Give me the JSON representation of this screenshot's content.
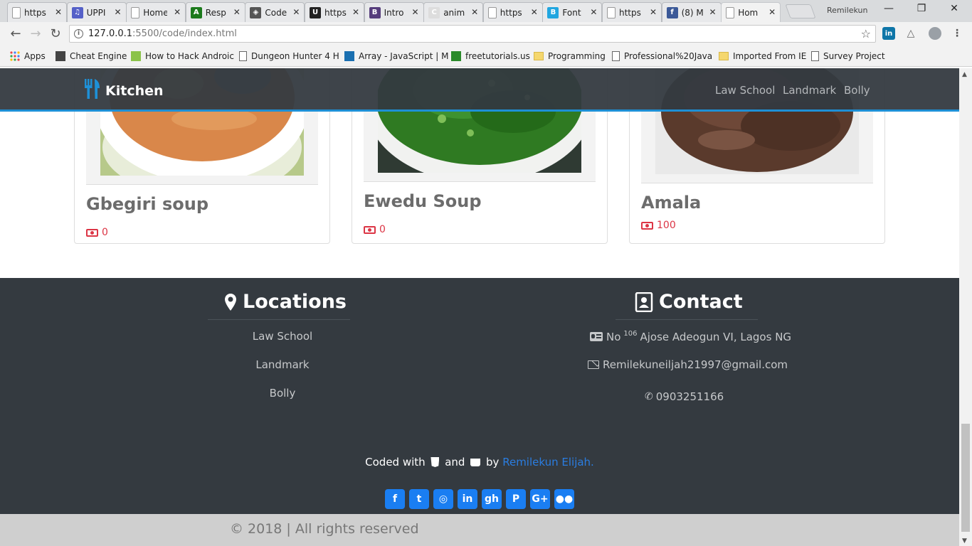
{
  "browser": {
    "tabs": [
      {
        "title": "https",
        "favicon": "page-icon",
        "color": "#999999",
        "letter": ""
      },
      {
        "title": "UPPI",
        "favicon": "itunes-icon",
        "color": "#5560c8",
        "letter": "♫"
      },
      {
        "title": "Home",
        "favicon": "page-icon",
        "color": "#999999",
        "letter": ""
      },
      {
        "title": "Resp",
        "favicon": "green-icon",
        "color": "#1c7a1c",
        "letter": "A"
      },
      {
        "title": "Code",
        "favicon": "codepen-icon",
        "color": "#555555",
        "letter": "◈"
      },
      {
        "title": "https",
        "favicon": "udemy-icon",
        "color": "#222222",
        "letter": "U"
      },
      {
        "title": "Intro",
        "favicon": "bootstrap-icon",
        "color": "#563d7c",
        "letter": "B"
      },
      {
        "title": "anim",
        "favicon": "c-icon",
        "color": "#dddddd",
        "letter": "C"
      },
      {
        "title": "https",
        "favicon": "page-icon",
        "color": "#999999",
        "letter": ""
      },
      {
        "title": "Font",
        "favicon": "b-icon",
        "color": "#21a6e0",
        "letter": "B"
      },
      {
        "title": "https",
        "favicon": "page-icon",
        "color": "#999999",
        "letter": ""
      },
      {
        "title": "(8) M",
        "favicon": "facebook-icon",
        "color": "#3b5998",
        "letter": "f"
      },
      {
        "title": "Hom",
        "favicon": "page-icon",
        "color": "#999999",
        "letter": ""
      }
    ],
    "profile_name": "Remilekun",
    "url_host": "127.0.0.1",
    "url_path": ":5500/code/index.html",
    "bookmarks": [
      {
        "label": "Apps",
        "icon": "apps-icon"
      },
      {
        "label": "Cheat Engine",
        "icon": "cheat-engine-icon"
      },
      {
        "label": "How to Hack Androic",
        "icon": "android-icon"
      },
      {
        "label": "Dungeon Hunter 4 H",
        "icon": "page-icon"
      },
      {
        "label": "Array - JavaScript | M",
        "icon": "mdn-icon"
      },
      {
        "label": "freetutorials.us",
        "icon": "ftu-icon"
      },
      {
        "label": "Programming",
        "icon": "folder-icon"
      },
      {
        "label": "Professional%20Java",
        "icon": "page-icon"
      },
      {
        "label": "Imported From IE",
        "icon": "folder-icon"
      },
      {
        "label": "Survey Project",
        "icon": "page-icon"
      }
    ]
  },
  "navbar": {
    "brand": "Kitchen",
    "links": [
      "Law School",
      "Landmark",
      "Bolly"
    ],
    "accent": "#1e90d6"
  },
  "cards": [
    {
      "name": "Gbegiri soup",
      "price": "0",
      "image": "gbegiri-soup-image"
    },
    {
      "name": "Ewedu Soup",
      "price": "0",
      "image": "ewedu-soup-image"
    },
    {
      "name": "Amala",
      "price": "100",
      "image": "amala-image"
    }
  ],
  "footer": {
    "locations_title": "Locations",
    "locations": [
      "Law School",
      "Landmark",
      "Bolly"
    ],
    "contact_title": "Contact",
    "address_prefix": "No",
    "address_number": "106",
    "address_rest": "Ajose Adeogun VI, Lagos NG",
    "email": "Remilekuneiljah21997@gmail.com",
    "phone": "0903251166",
    "coded_with": "Coded with",
    "and": "and",
    "by": "by",
    "author": "Remilekun Elijah.",
    "socials": [
      {
        "name": "facebook",
        "glyph": "f"
      },
      {
        "name": "twitter",
        "glyph": "t"
      },
      {
        "name": "instagram",
        "glyph": "◎"
      },
      {
        "name": "linkedin",
        "glyph": "in"
      },
      {
        "name": "github",
        "glyph": "gh"
      },
      {
        "name": "pinterest",
        "glyph": "P"
      },
      {
        "name": "google-plus",
        "glyph": "G+"
      },
      {
        "name": "flickr",
        "glyph": "●●"
      }
    ],
    "copyright": "© 2018 | All rights reserved"
  }
}
